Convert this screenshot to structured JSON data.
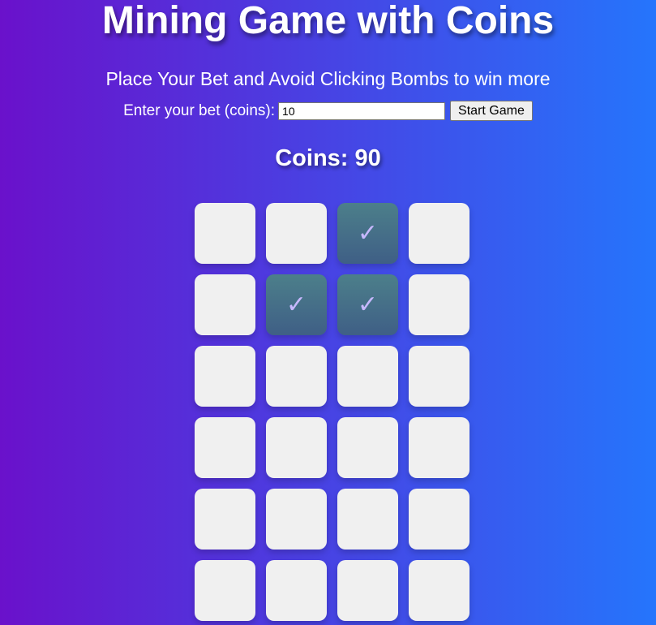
{
  "header": {
    "title": "Mining Game with Coins",
    "subtitle": "Place Your Bet and Avoid Clicking Bombs to win more"
  },
  "bet": {
    "label": "Enter your bet (coins):",
    "value": "10",
    "start_label": "Start Game"
  },
  "status": {
    "coins_text": "Coins: 90"
  },
  "grid": {
    "columns": 4,
    "rows": 6,
    "check_glyph": "✓",
    "tiles": [
      {
        "state": "hidden"
      },
      {
        "state": "hidden"
      },
      {
        "state": "safe"
      },
      {
        "state": "hidden"
      },
      {
        "state": "hidden"
      },
      {
        "state": "safe"
      },
      {
        "state": "safe"
      },
      {
        "state": "hidden"
      },
      {
        "state": "hidden"
      },
      {
        "state": "hidden"
      },
      {
        "state": "hidden"
      },
      {
        "state": "hidden"
      },
      {
        "state": "hidden"
      },
      {
        "state": "hidden"
      },
      {
        "state": "hidden"
      },
      {
        "state": "hidden"
      },
      {
        "state": "hidden"
      },
      {
        "state": "hidden"
      },
      {
        "state": "hidden"
      },
      {
        "state": "hidden"
      },
      {
        "state": "hidden"
      },
      {
        "state": "hidden"
      },
      {
        "state": "hidden"
      },
      {
        "state": "hidden"
      }
    ]
  },
  "colors": {
    "gradient_start": "#6a11cb",
    "gradient_end": "#2575fc",
    "tile_hidden": "#f0f0f0",
    "tile_revealed": "#4c7f8a",
    "check_color": "#c7b8ff"
  }
}
